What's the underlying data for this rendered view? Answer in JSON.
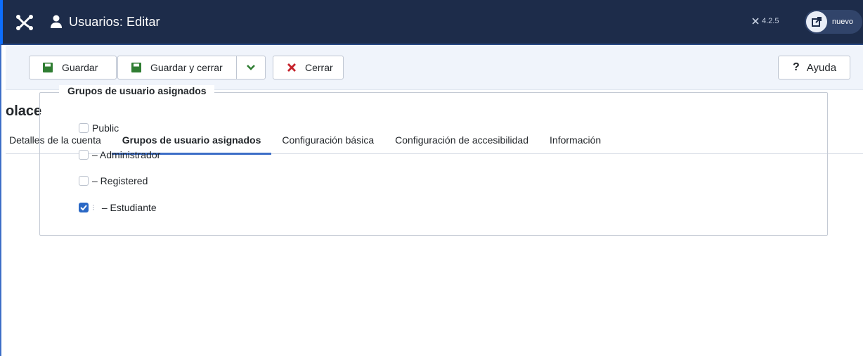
{
  "header": {
    "title": "Usuarios: Editar",
    "version": "4.2.5",
    "new_label": "nuevo",
    "logo_icon": "joomla-logo-icon",
    "user_icon": "user-icon",
    "external_icon": "external-link-icon"
  },
  "toolbar": {
    "save_label": "Guardar",
    "save_close_label": "Guardar y cerrar",
    "close_label": "Cerrar",
    "help_label": "Ayuda"
  },
  "record": {
    "title": "olace"
  },
  "tabs": [
    {
      "label": "Detalles de la cuenta",
      "active": false
    },
    {
      "label": "Grupos de usuario asignados",
      "active": true
    },
    {
      "label": "Configuración básica",
      "active": false
    },
    {
      "label": "Configuración de accesibilidad",
      "active": false
    },
    {
      "label": "Información",
      "active": false
    }
  ],
  "groups": {
    "legend": "Grupos de usuario asignados",
    "items": [
      {
        "label": "Public",
        "checked": false
      },
      {
        "label": "– Administrador",
        "checked": false
      },
      {
        "label": "– Registered",
        "checked": false
      },
      {
        "label": "– Estudiante",
        "checked": true,
        "marker": "⁝"
      }
    ]
  },
  "colors": {
    "header_bg": "#1d2c4a",
    "accent": "#3d6ec7",
    "save_icon": "#2f7d32",
    "close_icon": "#c5222b",
    "checkbox_checked": "#2a68c5"
  }
}
